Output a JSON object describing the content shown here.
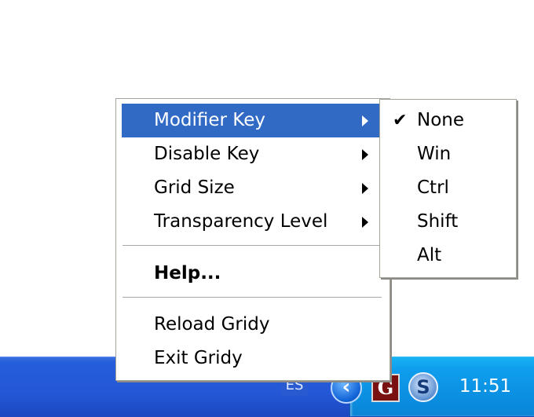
{
  "context_menu": {
    "items": [
      {
        "label": "Modifier Key",
        "has_submenu": true,
        "highlighted": true
      },
      {
        "label": "Disable Key",
        "has_submenu": true
      },
      {
        "label": "Grid Size",
        "has_submenu": true
      },
      {
        "label": "Transparency Level",
        "has_submenu": true
      },
      {
        "label": "Help...",
        "bold": true
      },
      {
        "label": "Reload Gridy"
      },
      {
        "label": "Exit Gridy"
      }
    ]
  },
  "submenu": {
    "items": [
      {
        "label": "None",
        "checked": true
      },
      {
        "label": "Win"
      },
      {
        "label": "Ctrl"
      },
      {
        "label": "Shift"
      },
      {
        "label": "Alt"
      }
    ],
    "check_glyph": "✔"
  },
  "taskbar": {
    "language": "ES",
    "clock": "11:51",
    "tray_icons": [
      "show-hidden-icons-chevron-icon",
      "gridy-g-icon",
      "sync-s-icon"
    ],
    "chevron_glyph": "‹",
    "gridy_glyph": "G",
    "sync_glyph": "S"
  },
  "colors": {
    "highlight": "#316ac5",
    "taskbar": "#245edb",
    "tray": "#0f9eee"
  }
}
